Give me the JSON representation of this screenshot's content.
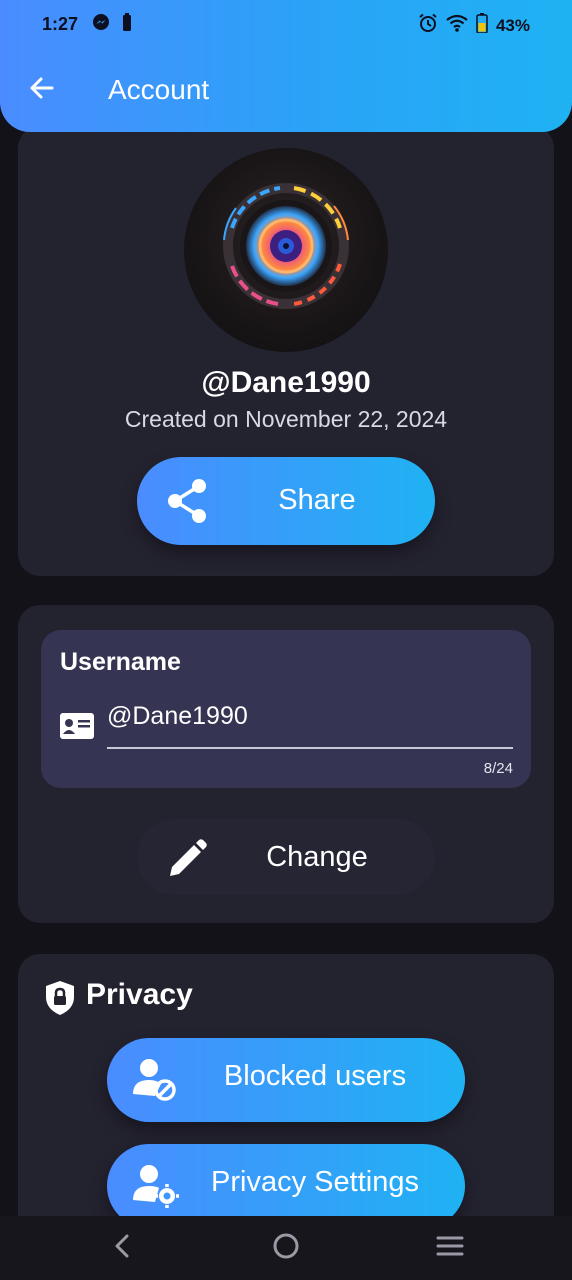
{
  "status_bar": {
    "time": "1:27",
    "battery": "43%"
  },
  "app_bar": {
    "title": "Account"
  },
  "profile": {
    "handle": "@Dane1990",
    "created": "Created on November 22, 2024",
    "share_label": "Share"
  },
  "username": {
    "label": "Username",
    "value": "@Dane1990",
    "counter": "8/24",
    "change_label": "Change"
  },
  "privacy": {
    "title": "Privacy",
    "blocked_label": "Blocked users",
    "settings_label": "Privacy Settings"
  },
  "colors": {
    "accent_start": "#4a8cff",
    "accent_end": "#1fb2f3",
    "background": "#131219",
    "card": "#23222f",
    "input": "#353452"
  },
  "icons": [
    "back-arrow-icon",
    "messenger-icon",
    "battery-icon",
    "alarm-icon",
    "wifi-icon",
    "share-icon",
    "id-card-icon",
    "pencil-icon",
    "shield-lock-icon",
    "user-blocked-icon",
    "user-gear-icon"
  ]
}
